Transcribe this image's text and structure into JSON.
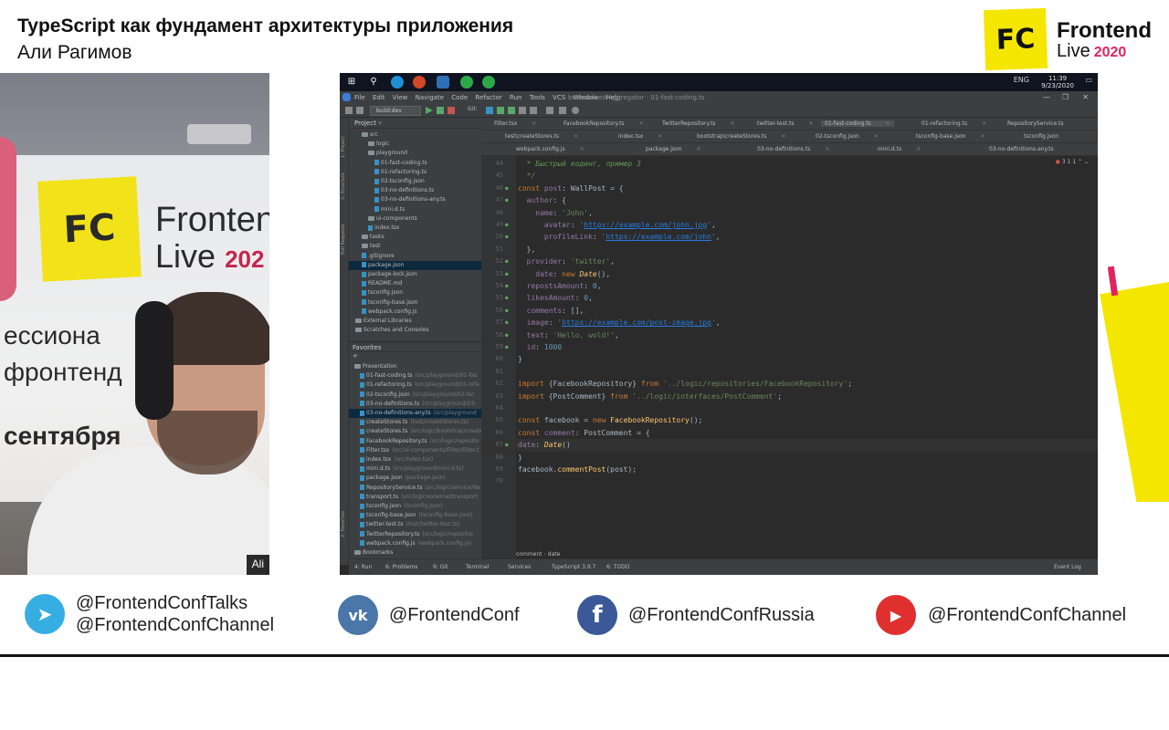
{
  "header": {
    "title": "TypeScript как фундамент архитектуры приложения",
    "speaker": "Али Рагимов",
    "logo_mark": "FC",
    "logo_line1": "Frontend",
    "logo_line2": "Live",
    "logo_year": "2020"
  },
  "webcam": {
    "name_tag": "Ali",
    "banner_mark": "FC",
    "banner_line1": "Fronten",
    "banner_line2": "Live",
    "banner_year": "202",
    "backdrop_text1": "ессиона",
    "backdrop_text2": "фронтенд",
    "backdrop_text3": "сентября"
  },
  "ide": {
    "window_title": "broken-feed-aggregator - 01-fast-coding.ts",
    "menu": [
      "File",
      "Edit",
      "View",
      "Navigate",
      "Code",
      "Refactor",
      "Run",
      "Tools",
      "VCS",
      "Window",
      "Help"
    ],
    "run_config": "build:dev",
    "clock_time": "11:39",
    "clock_date": "9/23/2020",
    "lang": "ENG",
    "project_panel_title": "Project",
    "favorites_title": "Favorites",
    "tree": [
      {
        "label": "src",
        "depth": 2,
        "kind": "folder"
      },
      {
        "label": "logic",
        "depth": 3,
        "kind": "folder"
      },
      {
        "label": "playground",
        "depth": 3,
        "kind": "folder"
      },
      {
        "label": "01-fast-coding.ts",
        "depth": 4,
        "kind": "file"
      },
      {
        "label": "01-refactoring.ts",
        "depth": 4,
        "kind": "file"
      },
      {
        "label": "02-tsconfig.json",
        "depth": 4,
        "kind": "file"
      },
      {
        "label": "03-no-definitions.ts",
        "depth": 4,
        "kind": "file"
      },
      {
        "label": "03-no-definitions-any.ts",
        "depth": 4,
        "kind": "file"
      },
      {
        "label": "mini.d.ts",
        "depth": 4,
        "kind": "file"
      },
      {
        "label": "ui-components",
        "depth": 3,
        "kind": "folder"
      },
      {
        "label": "index.tsx",
        "depth": 3,
        "kind": "file"
      },
      {
        "label": "tasks",
        "depth": 2,
        "kind": "folder"
      },
      {
        "label": "test",
        "depth": 2,
        "kind": "folder"
      },
      {
        "label": ".gitignore",
        "depth": 2,
        "kind": "file"
      },
      {
        "label": "package.json",
        "depth": 2,
        "kind": "file",
        "selected": true
      },
      {
        "label": "package-lock.json",
        "depth": 2,
        "kind": "file"
      },
      {
        "label": "README.md",
        "depth": 2,
        "kind": "file"
      },
      {
        "label": "tsconfig.json",
        "depth": 2,
        "kind": "file"
      },
      {
        "label": "tsconfig-base.json",
        "depth": 2,
        "kind": "file"
      },
      {
        "label": "webpack.config.js",
        "depth": 2,
        "kind": "file"
      },
      {
        "label": "External Libraries",
        "depth": 1,
        "kind": "folder"
      },
      {
        "label": "Scratches and Consoles",
        "depth": 1,
        "kind": "folder"
      }
    ],
    "favorites": [
      {
        "label": "Presentation",
        "hint": "",
        "depth": 1
      },
      {
        "label": "01-fast-coding.ts",
        "hint": "(src/playground/01-fas",
        "depth": 2
      },
      {
        "label": "01-refactoring.ts",
        "hint": "(src/playground/01-refa",
        "depth": 2
      },
      {
        "label": "02-tsconfig.json",
        "hint": "(src/playground/02-tsc",
        "depth": 2
      },
      {
        "label": "03-no-definitions.ts",
        "hint": "(src/playground/03-",
        "depth": 2
      },
      {
        "label": "03-no-definitions-any.ts",
        "hint": "(src/playground",
        "depth": 2,
        "selected": true
      },
      {
        "label": "createStores.ts",
        "hint": "(test/createStores.ts)",
        "depth": 2
      },
      {
        "label": "createStores.ts",
        "hint": "(src/logic/bootstrap/create",
        "depth": 2
      },
      {
        "label": "FacebookRepository.ts",
        "hint": "(src/logic/reposito",
        "depth": 2
      },
      {
        "label": "Filter.tsx",
        "hint": "(src/ui-components/Filter/Filter.t",
        "depth": 2
      },
      {
        "label": "index.tsx",
        "hint": "(src/index.tsx)",
        "depth": 2
      },
      {
        "label": "mini.d.ts",
        "hint": "(src/playground/mini.d.ts)",
        "depth": 2
      },
      {
        "label": "package.json",
        "hint": "(package.json)",
        "depth": 2
      },
      {
        "label": "RepositoryService.ts",
        "hint": "(src/logic/service/Re",
        "depth": 2
      },
      {
        "label": "transport.ts",
        "hint": "(src/logic/external/transport",
        "depth": 2
      },
      {
        "label": "tsconfig.json",
        "hint": "(tsconfig.json)",
        "depth": 2
      },
      {
        "label": "tsconfig-base.json",
        "hint": "(tsconfig-base.json)",
        "depth": 2
      },
      {
        "label": "twitter-test.ts",
        "hint": "(test/twitter-test.ts)",
        "depth": 2
      },
      {
        "label": "TwitterRepository.ts",
        "hint": "(src/logic/repositor",
        "depth": 2
      },
      {
        "label": "webpack.config.js",
        "hint": "(webpack.config.js)",
        "depth": 2
      },
      {
        "label": "Bookmarks",
        "hint": "",
        "depth": 1
      }
    ],
    "tab_rows": [
      [
        "Filter.tsx",
        "FacebookRepository.ts",
        "TwitterRepository.ts",
        "twitter-test.ts",
        "01-fast-coding.ts",
        "01-refactoring.ts",
        "RepositoryService.ts"
      ],
      [
        "test\\createStores.ts",
        "index.tsx",
        "bootstrap\\createStores.ts",
        "02-tsconfig.json",
        "tsconfig-base.json",
        "tsconfig.json"
      ],
      [
        "webpack.config.js",
        "package.json",
        "03-no-definitions.ts",
        "mini.d.ts",
        "03-no-definitions-any.ts"
      ]
    ],
    "inspection": "3  1  1",
    "breadcrumb": [
      "comment",
      "date"
    ],
    "bottom_tools": [
      "4: Run",
      "6: Problems",
      "9: Git",
      "Terminal",
      "Services",
      "TypeScript 3.9.7",
      "6: TODO"
    ],
    "event_log": "Event Log",
    "code": [
      {
        "n": "44",
        "text": "  * Быстрый кодинг, пример 3"
      },
      {
        "n": "45",
        "text": "  */"
      },
      {
        "n": "46",
        "text": "const post: WallPost = {"
      },
      {
        "n": "47",
        "text": "  author: {"
      },
      {
        "n": "48",
        "text": "    name: 'John',"
      },
      {
        "n": "49",
        "text": "      avatar: 'https://example.com/john.jpg',"
      },
      {
        "n": "50",
        "text": "      profileLink: 'https://example.com/john',"
      },
      {
        "n": "51",
        "text": "  },"
      },
      {
        "n": "52",
        "text": "  provider: 'twitter',"
      },
      {
        "n": "53",
        "text": "    date: new Date(),"
      },
      {
        "n": "54",
        "text": "  repostsAmount: 0,"
      },
      {
        "n": "55",
        "text": "  likesAmount: 0,"
      },
      {
        "n": "56",
        "text": "  comments: [],"
      },
      {
        "n": "57",
        "text": "  image: 'https://example.com/post-image.jpg',"
      },
      {
        "n": "58",
        "text": "  text: 'Hello, wold!',"
      },
      {
        "n": "59",
        "text": "  id: 1000"
      },
      {
        "n": "60",
        "text": "}"
      },
      {
        "n": "61",
        "text": ""
      },
      {
        "n": "62",
        "text": "import {FacebookRepository} from '../logic/repositories/FacebookRepository';"
      },
      {
        "n": "63",
        "text": "import {PostComment} from '../logic/interfaces/PostComment';"
      },
      {
        "n": "64",
        "text": ""
      },
      {
        "n": "65",
        "text": "const facebook = new FacebookRepository();"
      },
      {
        "n": "66",
        "text": "const comment: PostComment = {"
      },
      {
        "n": "67",
        "text": "date: Date()"
      },
      {
        "n": "68",
        "text": "}"
      },
      {
        "n": "69",
        "text": "facebook.commentPost(post);"
      },
      {
        "n": "70",
        "text": ""
      }
    ]
  },
  "footer": {
    "telegram": [
      "@FrontendConfTalks",
      "@FrontendConfChannel"
    ],
    "vk": "@FrontendConf",
    "facebook": "@FrontendConfRussia",
    "youtube": "@FrontendConfChannel",
    "colors": {
      "telegram": "#37aee2",
      "vk": "#4a76a8",
      "facebook": "#3b5998",
      "youtube": "#e02f2f"
    }
  },
  "colors": {
    "accent_yellow": "#f5e600",
    "accent_pink": "#e0245e"
  }
}
